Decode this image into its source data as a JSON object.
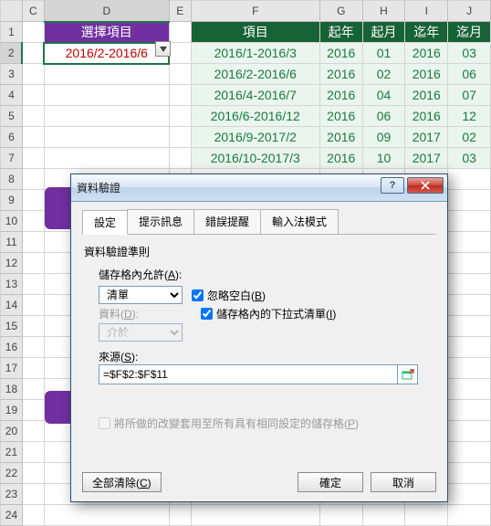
{
  "columns": [
    "C",
    "D",
    "E",
    "F",
    "G",
    "H",
    "I",
    "J"
  ],
  "headers": {
    "D": "選擇項目",
    "F": "項目",
    "G": "起年",
    "H": "起月",
    "I": "迄年",
    "J": "迄月"
  },
  "selected_cell": {
    "value": "2016/2-2016/6"
  },
  "data_rows": [
    {
      "F": "2016/1-2016/3",
      "G": "2016",
      "H": "01",
      "I": "2016",
      "J": "03"
    },
    {
      "F": "2016/2-2016/6",
      "G": "2016",
      "H": "02",
      "I": "2016",
      "J": "06"
    },
    {
      "F": "2016/4-2016/7",
      "G": "2016",
      "H": "04",
      "I": "2016",
      "J": "07"
    },
    {
      "F": "2016/6-2016/12",
      "G": "2016",
      "H": "06",
      "I": "2016",
      "J": "12"
    },
    {
      "F": "2016/9-2017/2",
      "G": "2016",
      "H": "09",
      "I": "2017",
      "J": "02"
    },
    {
      "F": "2016/10-2017/3",
      "G": "2016",
      "H": "10",
      "I": "2017",
      "J": "03"
    }
  ],
  "row_count": 24,
  "dialog": {
    "title": "資料驗證",
    "tabs": [
      "設定",
      "提示訊息",
      "錯誤提醒",
      "輸入法模式"
    ],
    "active_tab": 0,
    "section": "資料驗證準則",
    "allow_label": "儲存格內允許(A):",
    "allow_value": "清單",
    "ignore_blank": "忽略空白(B)",
    "dropdown_in_cell": "儲存格內的下拉式清單(I)",
    "data_label": "資料(D):",
    "data_value": "介於",
    "source_label": "來源(S):",
    "source_value": "=$F$2:$F$11",
    "apply_all": "將所做的改變套用至所有具有相同設定的儲存格(P)",
    "clear_all": "全部清除(C)",
    "ok": "確定",
    "cancel": "取消"
  }
}
